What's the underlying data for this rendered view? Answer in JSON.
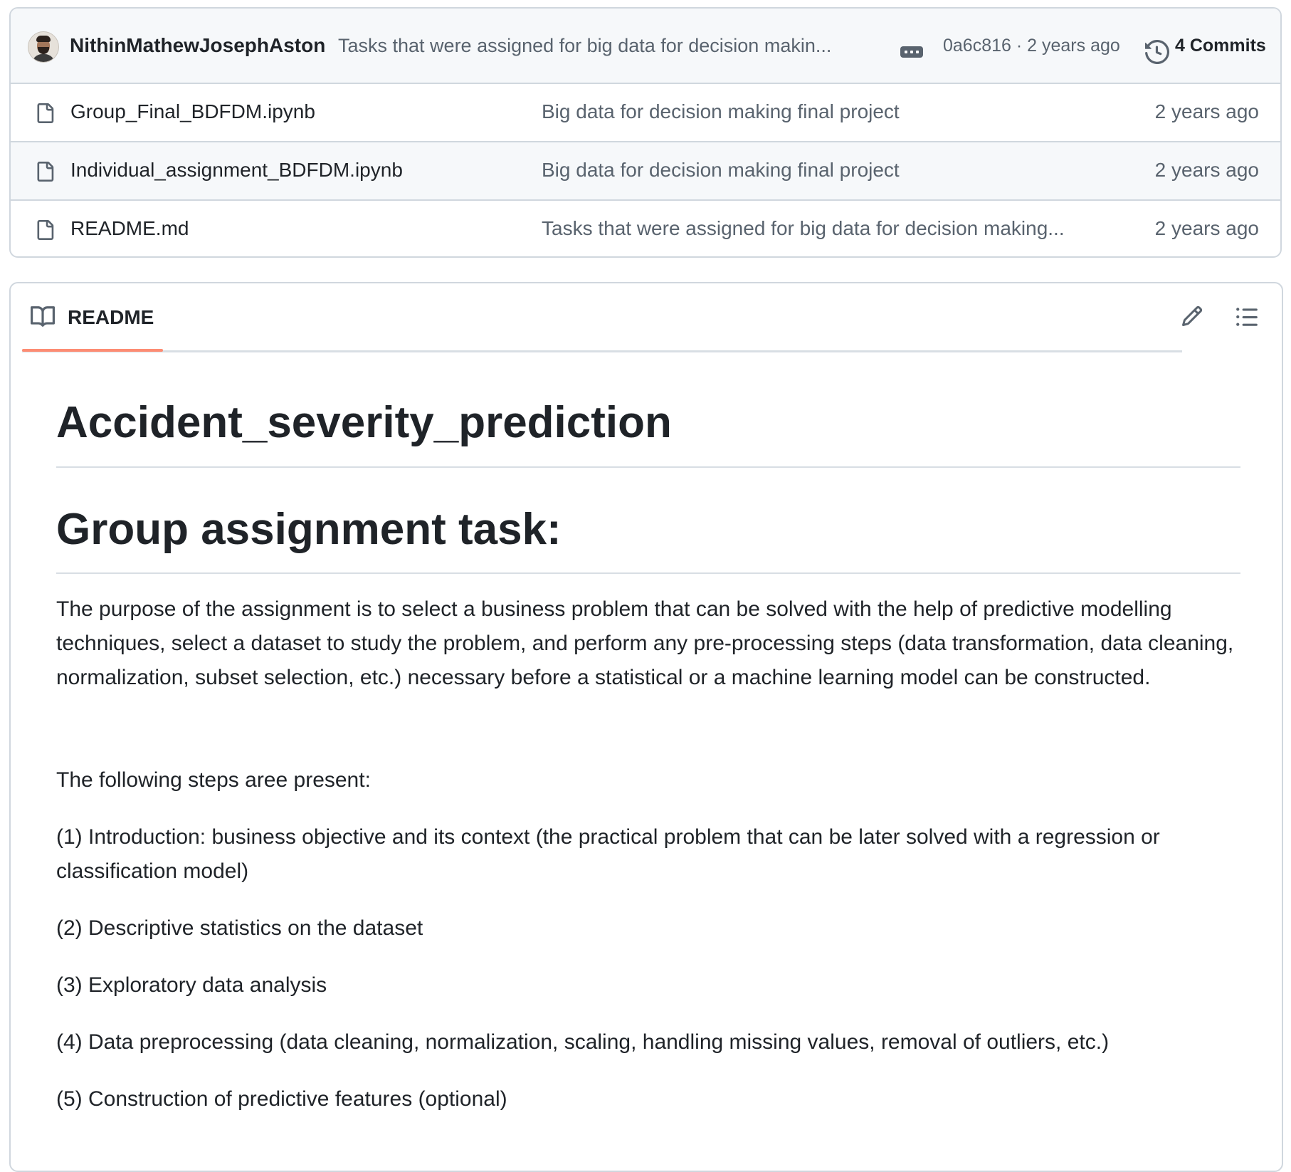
{
  "commit_bar": {
    "author": "NithinMathewJosephAston",
    "message": "Tasks that were assigned for big data for decision makin...",
    "sha_time": "0a6c816 · 2 years ago",
    "commits_label": "4 Commits"
  },
  "files": [
    {
      "name": "Group_Final_BDFDM.ipynb",
      "message": "Big data for decision making final project",
      "date": "2 years ago"
    },
    {
      "name": "Individual_assignment_BDFDM.ipynb",
      "message": "Big data for decision making final project",
      "date": "2 years ago"
    },
    {
      "name": "README.md",
      "message": "Tasks that were assigned for big data for decision making...",
      "date": "2 years ago"
    }
  ],
  "readme": {
    "tab_label": "README",
    "title": "Accident_severity_prediction",
    "subtitle": "Group assignment task:",
    "paragraphs": [
      "The purpose of the assignment is to select a business problem that can be solved with the help of predictive modelling techniques, select a dataset to study the problem, and perform any pre-processing steps (data transformation, data cleaning, normalization, subset selection, etc.) necessary before a statistical or a machine learning model can be constructed.",
      "The following steps aree present:",
      "(1) Introduction: business objective and its context (the practical problem that can be later solved with a regression or classification model)",
      "(2) Descriptive statistics on the dataset",
      "(3) Exploratory data analysis",
      "(4) Data preprocessing (data cleaning, normalization, scaling, handling missing values, removal of outliers, etc.)",
      "(5) Construction of predictive features (optional)"
    ]
  },
  "colors": {
    "border": "#d0d7de",
    "muted_text": "#59636e",
    "text": "#1f2328",
    "header_bg": "#f6f8fa",
    "tab_underline": "#fd8c73"
  },
  "icons": {
    "avatar": "user-avatar",
    "ellipsis": "ellipsis-icon",
    "history": "history-icon",
    "file": "file-icon",
    "book": "book-icon",
    "edit": "pencil-icon",
    "toc": "list-unordered-icon"
  }
}
